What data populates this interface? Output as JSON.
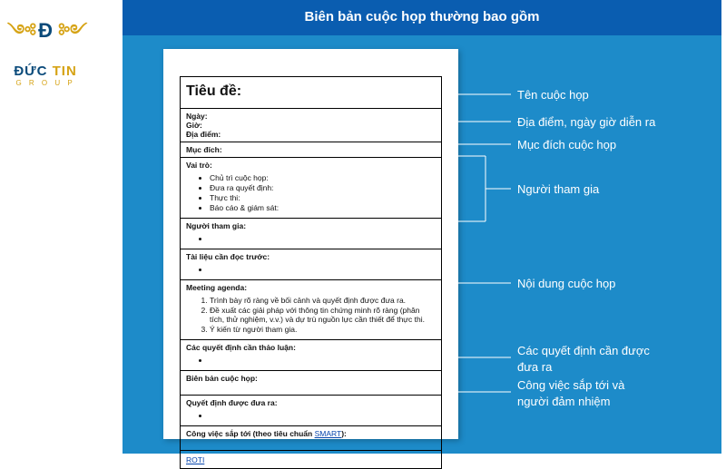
{
  "logo": {
    "brand": "ĐỨC TIN",
    "brand_a": "ĐỨC ",
    "brand_b": "TIN",
    "sub": "G R O U P"
  },
  "header": "Biên bản cuộc họp thường bao gồm",
  "doc": {
    "title_label": "Tiêu đề:",
    "date_label": "Ngày:",
    "time_label": "Giờ:",
    "place_label": "Địa điểm:",
    "purpose_label": "Mục đích:",
    "roles_label": "Vai trò:",
    "role_items": [
      "Chủ trì cuộc họp:",
      "Đưa ra quyết định:",
      "Thực thi:",
      "Báo cáo & giám sát:"
    ],
    "attendees_label": "Người tham gia:",
    "preread_label": "Tài liệu cần đọc trước:",
    "agenda_label": "Meeting agenda:",
    "agenda_items": [
      "Trình bày rõ ràng về bối cảnh và quyết định được đưa ra.",
      "Đề xuất các giải pháp với thông tin chứng minh rõ ràng (phân tích, thử nghiệm, v.v.) và dự trù nguồn lực cần thiết để thực thi.",
      "Ý kiến từ người tham gia."
    ],
    "discuss_label": "Các quyết định cần thảo luận:",
    "minutes_label": "Biên bản cuộc họp:",
    "decided_label": "Quyết định được đưa ra:",
    "next_label_a": "Công việc sắp tới (theo tiêu chuẩn ",
    "next_link": "SMART",
    "next_label_b": "):",
    "roti_link": "ROTI"
  },
  "annotations": [
    "Tên cuộc họp",
    "Địa điểm, ngày giờ diễn ra",
    "Mục đích cuộc họp",
    "Người tham gia",
    "Nội dung cuộc họp",
    "Các quyết định cần được\nđưa ra",
    "Công việc sắp tới và\nngười đảm nhiệm"
  ]
}
